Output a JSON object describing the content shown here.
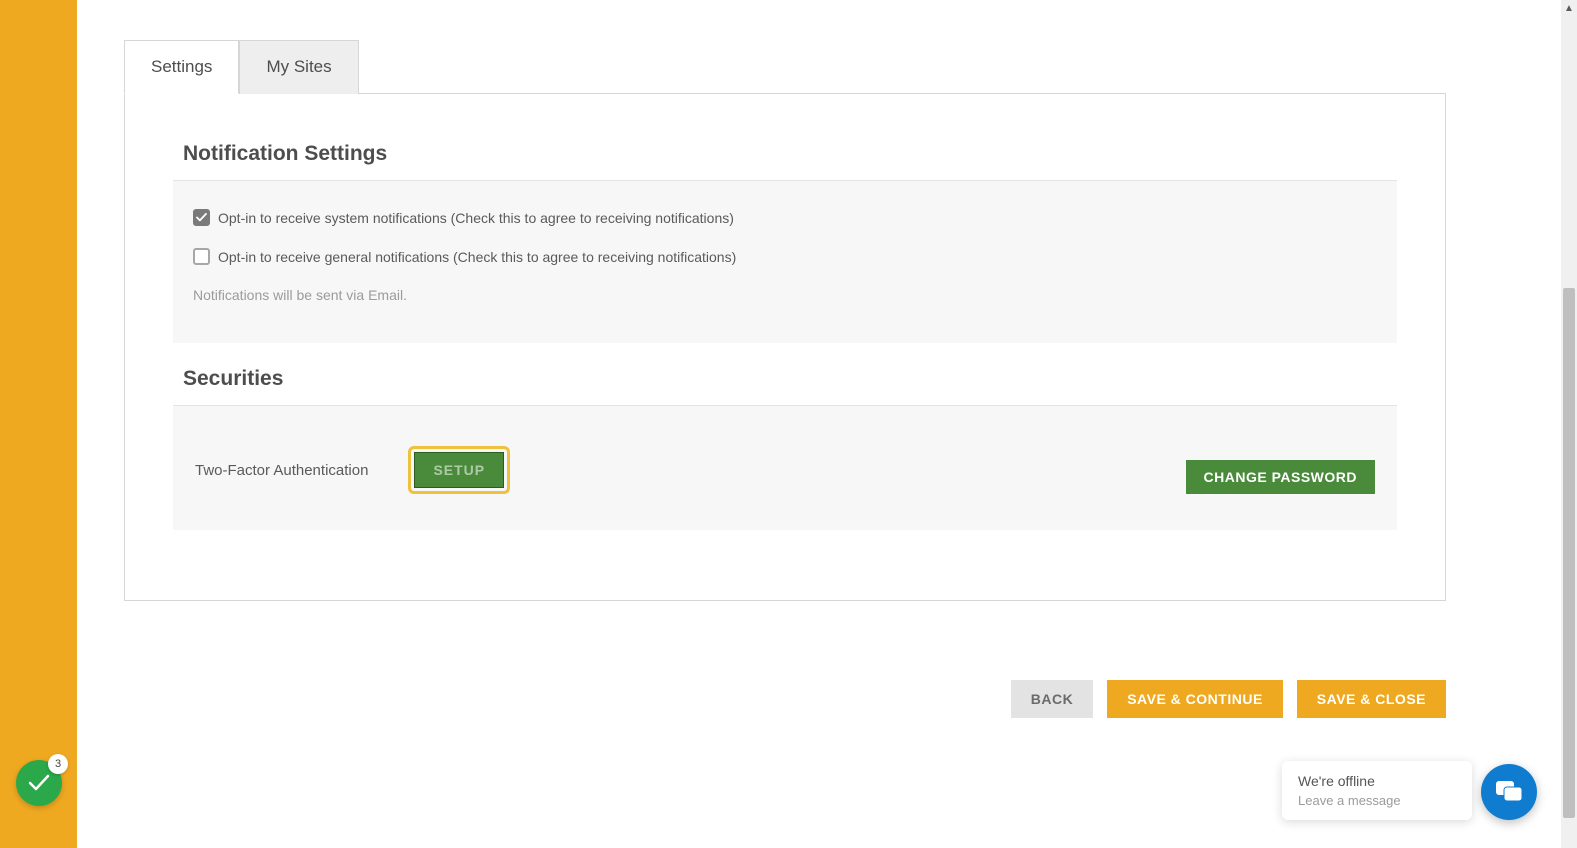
{
  "tabs": {
    "settings": "Settings",
    "mysites": "My Sites"
  },
  "notifications": {
    "heading": "Notification Settings",
    "opt_system": {
      "label": "Opt-in to receive system notifications (Check this to agree to receiving notifications)",
      "checked": true
    },
    "opt_general": {
      "label": "Opt-in to receive general notifications (Check this to agree to receiving notifications)",
      "checked": false
    },
    "note": "Notifications will be sent via Email."
  },
  "securities": {
    "heading": "Securities",
    "tfa_label": "Two-Factor Authentication",
    "setup_btn": "SETUP",
    "change_pw_btn": "CHANGE PASSWORD"
  },
  "footer": {
    "back": "BACK",
    "save_continue": "SAVE & CONTINUE",
    "save_close": "SAVE & CLOSE"
  },
  "badge": {
    "count": "3"
  },
  "chat": {
    "title": "We're offline",
    "subtitle": "Leave a message"
  }
}
